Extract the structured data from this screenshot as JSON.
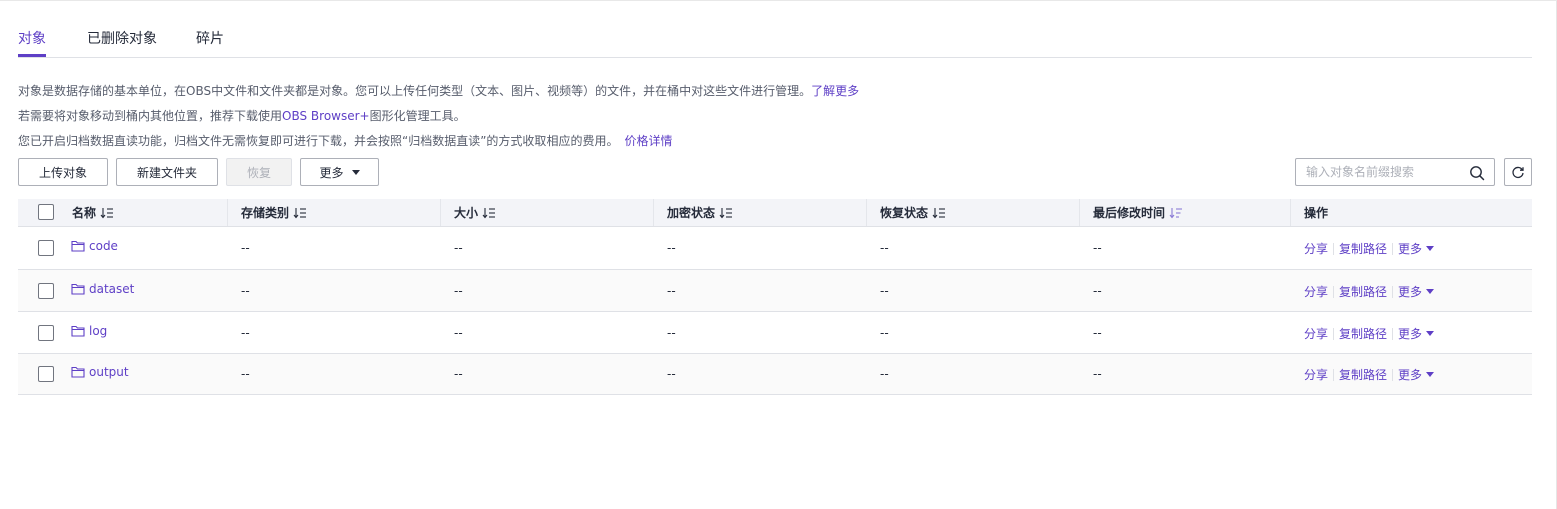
{
  "tabs": [
    {
      "label": "对象",
      "active": true
    },
    {
      "label": "已删除对象",
      "active": false
    },
    {
      "label": "碎片",
      "active": false
    }
  ],
  "info": {
    "line1_text": "对象是数据存储的基本单位，在OBS中文件和文件夹都是对象。您可以上传任何类型（文本、图片、视频等）的文件，并在桶中对这些文件进行管理。",
    "line1_link": "了解更多",
    "line2_prefix": "若需要将对象移动到桶内其他位置，推荐下载使用",
    "line2_link": "OBS Browser+",
    "line2_suffix": "图形化管理工具。",
    "line3_text": "您已开启归档数据直读功能，归档文件无需恢复即可进行下载，并会按照“归档数据直读”的方式收取相应的费用。",
    "line3_link": "价格详情"
  },
  "toolbar": {
    "upload_label": "上传对象",
    "new_folder_label": "新建文件夹",
    "restore_label": "恢复",
    "more_label": "更多"
  },
  "search": {
    "placeholder": "输入对象名前缀搜索",
    "value": ""
  },
  "table": {
    "headers": {
      "name": "名称",
      "storage_class": "存储类别",
      "size": "大小",
      "encryption": "加密状态",
      "restore_status": "恢复状态",
      "last_modified": "最后修改时间",
      "operations": "操作"
    },
    "rows": [
      {
        "name": "code",
        "storage_class": "--",
        "size": "--",
        "encryption": "--",
        "restore_status": "--",
        "last_modified": "--"
      },
      {
        "name": "dataset",
        "storage_class": "--",
        "size": "--",
        "encryption": "--",
        "restore_status": "--",
        "last_modified": "--"
      },
      {
        "name": "log",
        "storage_class": "--",
        "size": "--",
        "encryption": "--",
        "restore_status": "--",
        "last_modified": "--"
      },
      {
        "name": "output",
        "storage_class": "--",
        "size": "--",
        "encryption": "--",
        "restore_status": "--",
        "last_modified": "--"
      }
    ],
    "row_actions": {
      "share": "分享",
      "copy_path": "复制路径",
      "more": "更多"
    }
  },
  "colors": {
    "accent": "#5e3fc6",
    "text": "#252b3a",
    "muted_text": "#575d6c",
    "header_bg": "#f3f4f8",
    "border": "#dfe1e6"
  }
}
